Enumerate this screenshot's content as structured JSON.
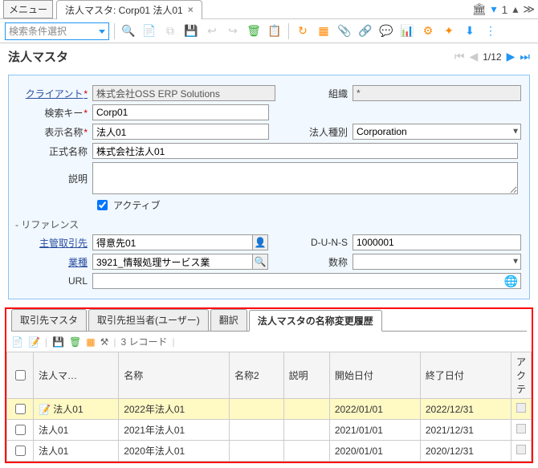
{
  "top": {
    "menu": "メニュー",
    "tab_title": "法人マスタ: Corp01 法人01",
    "close": "×",
    "page_info": "1",
    "more_nav": "≫"
  },
  "toolbar": {
    "search_placeholder": "検索条件選択"
  },
  "header": {
    "title": "法人マスタ",
    "pager": "1/12"
  },
  "form": {
    "labels": {
      "client": "クライアント",
      "org": "組織",
      "search_key": "検索キー",
      "display_name": "表示名称",
      "legal_type": "法人種別",
      "official_name": "正式名称",
      "description": "説明",
      "active": "アクティブ",
      "reference_section": "- リファレンス",
      "main_partner": "主管取引先",
      "industry": "業種",
      "duns": "D-U-N-S",
      "num_employees": "数称",
      "url": "URL"
    },
    "values": {
      "client": "株式会社OSS ERP Solutions",
      "org": "*",
      "search_key": "Corp01",
      "display_name": "法人01",
      "legal_type": "Corporation",
      "official_name": "株式会社法人01",
      "description": "",
      "main_partner": "得意先01",
      "industry": "3921_情報処理サービス業",
      "duns": "1000001",
      "num_employees": "",
      "url": ""
    }
  },
  "tabs": {
    "t1": "取引先マスタ",
    "t2": "取引先担当者(ユーザー)",
    "t3": "翻訳",
    "t4": "法人マスタの名称変更履歴"
  },
  "subtb": {
    "record_text": "3 レコード"
  },
  "table": {
    "headers": {
      "h1": "法人マ…",
      "h2": "名称",
      "h3": "名称2",
      "h4": "説明",
      "h5": "開始日付",
      "h6": "終了日付",
      "h7": "アクテ"
    },
    "rows": [
      {
        "corp": "法人01",
        "name": "2022年法人01",
        "name2": "",
        "desc": "",
        "start": "2022/01/01",
        "end": "2022/12/31",
        "sel": true
      },
      {
        "corp": "法人01",
        "name": "2021年法人01",
        "name2": "",
        "desc": "",
        "start": "2021/01/01",
        "end": "2021/12/31",
        "sel": false
      },
      {
        "corp": "法人01",
        "name": "2020年法人01",
        "name2": "",
        "desc": "",
        "start": "2020/01/01",
        "end": "2020/12/31",
        "sel": false
      }
    ]
  }
}
